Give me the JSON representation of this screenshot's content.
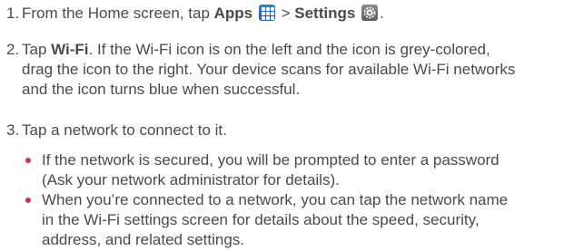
{
  "steps": [
    {
      "number": "1.",
      "parts": {
        "a": "From the Home screen, tap ",
        "apps": "Apps",
        "sep": " > ",
        "settings": "Settings",
        "end": "."
      }
    },
    {
      "number": "2.",
      "parts": {
        "a": "Tap ",
        "wifi": "Wi-Fi",
        "b": ". If the Wi-Fi icon is on the left and the icon is grey-colored,",
        "line2": "drag the icon to the right. Your device scans for available Wi-Fi networks",
        "line3": "and the icon turns blue when successful."
      }
    },
    {
      "number": "3.",
      "text": "Tap a network to connect to it."
    }
  ],
  "bullets": [
    {
      "line1": "If the network is secured, you will be prompted to enter a password",
      "line2": "(Ask your network administrator for details)."
    },
    {
      "line1": "When you’re connected to a network, you can tap the network name",
      "line2": "in the Wi-Fi settings screen for details about the speed, security,",
      "line3": "address, and related settings."
    }
  ],
  "icons": {
    "apps": "apps-grid-icon",
    "settings": "settings-gear-icon"
  },
  "colors": {
    "text": "#4a4a4a",
    "bullet": "#d6296b",
    "apps_icon": "#2f7de8",
    "settings_icon": "#6e6e6e"
  }
}
